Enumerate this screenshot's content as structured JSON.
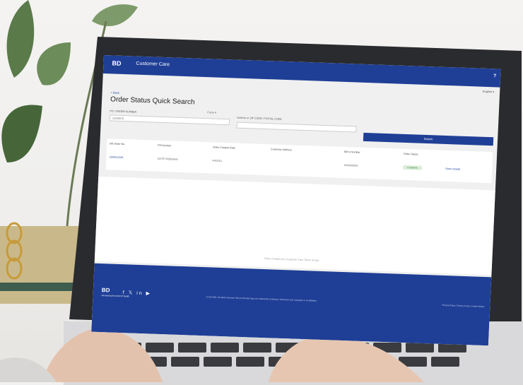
{
  "app": {
    "logo": "BD",
    "title": "Customer Care",
    "help": "?",
    "language": "English ▾"
  },
  "page": {
    "back": "< Back",
    "title": "Order Status Quick Search"
  },
  "search": {
    "po_label": "PO / ORDER NUMBER",
    "po_value": "12345678",
    "select": "Fuzzy",
    "address_label": "Address or ZIP CODE / POSTAL CODE",
    "button": "Search"
  },
  "table": {
    "headers": [
      "BD Order No.",
      "PO Number",
      "Order Created Date",
      "Customer Address",
      "Bill to Number",
      "Order Status"
    ],
    "row": {
      "order_no": "1300012345",
      "po": "SUITE FREEMAN",
      "date": "4/9/2021",
      "bill_to": "1000000000",
      "status": "Complete",
      "details": "Order Details"
    }
  },
  "footer": {
    "links": "FAQ  |  Contact Us  |  Customer Care Terms of Use",
    "logo": "BD",
    "tagline": "Advancing the world of health",
    "social": "f 𝕏 in ▶",
    "copyright": "© 2023 BD. All rights reserved. BD and the BD logo are trademarks of Becton, Dickinson and Company or its affiliates.",
    "legal": "Privacy Policy  |  Terms of Use  |  Cookie Notice"
  },
  "colors": {
    "brand": "#1f3f96"
  }
}
